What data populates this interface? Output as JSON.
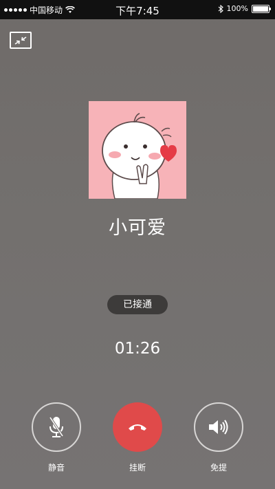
{
  "status_bar": {
    "carrier": "中国移动",
    "time": "下午7:45",
    "battery": "100%"
  },
  "call": {
    "caller_name": "小可爱",
    "status": "已接通",
    "timer": "01:26"
  },
  "controls": {
    "mute_label": "静音",
    "hangup_label": "挂断",
    "speaker_label": "免提"
  },
  "icons": {
    "minimize": "minimize-window-icon",
    "mute": "microphone-off-icon",
    "hangup": "phone-hangup-icon",
    "speaker": "speaker-icon"
  },
  "colors": {
    "hangup": "#e04a4a",
    "status_pill": "#3d3b3a",
    "avatar_bg": "#f7b3b8"
  }
}
